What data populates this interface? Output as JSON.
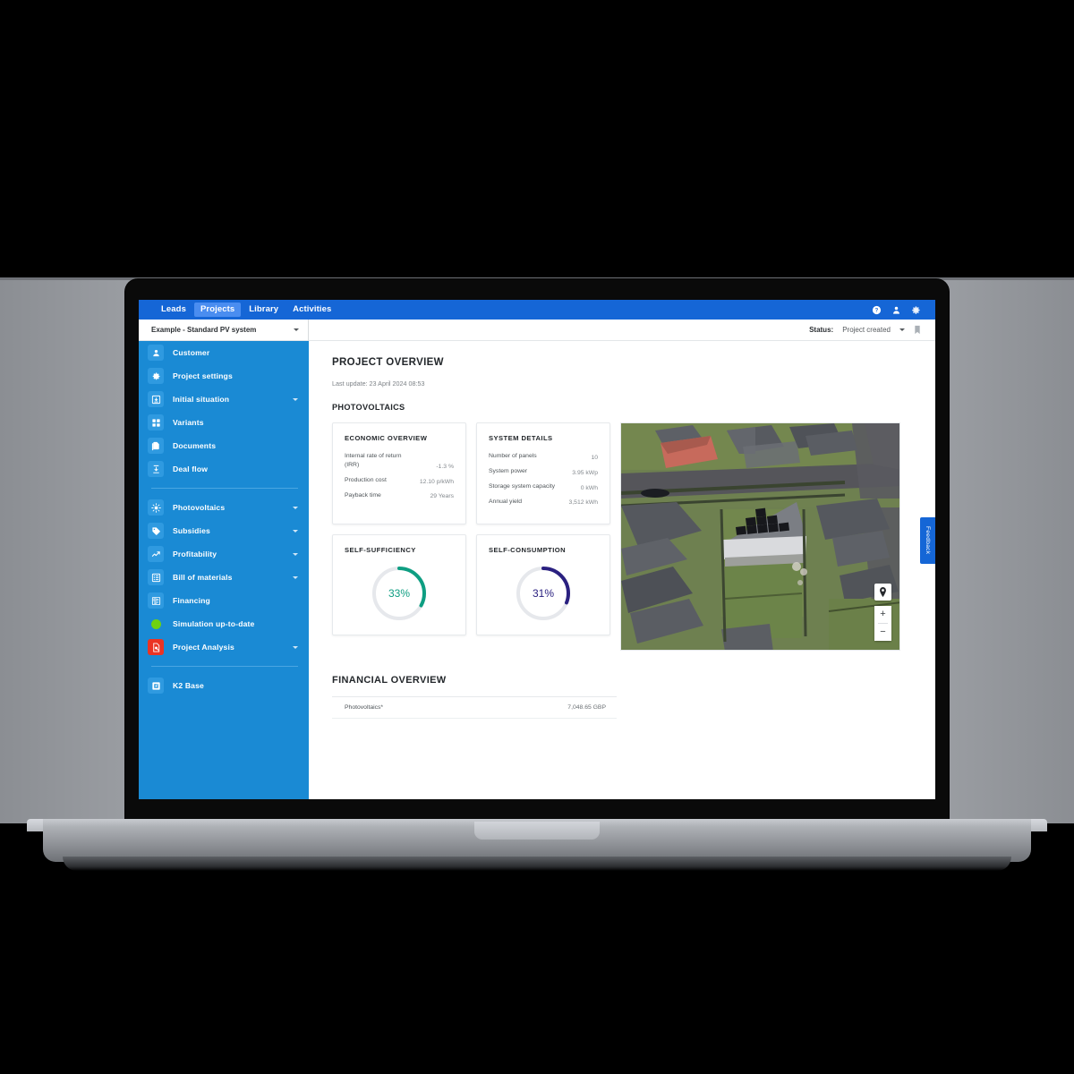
{
  "app": {
    "nav": [
      {
        "label": "Leads",
        "active": false
      },
      {
        "label": "Projects",
        "active": true
      },
      {
        "label": "Library",
        "active": false
      },
      {
        "label": "Activities",
        "active": false
      }
    ],
    "header_icons": [
      {
        "name": "help-icon",
        "glyph": "?"
      },
      {
        "name": "account-icon",
        "glyph": "person"
      },
      {
        "name": "settings-gear-icon",
        "glyph": "gear"
      }
    ]
  },
  "subbar": {
    "project_name": "Example - Standard PV system",
    "status_label": "Status:",
    "status_value": "Project created",
    "bookmark_icon": "bookmark-icon"
  },
  "sidebar": {
    "group1": [
      {
        "label": "Customer",
        "icon": "person-icon",
        "expandable": false
      },
      {
        "label": "Project settings",
        "icon": "gear-icon",
        "expandable": false
      },
      {
        "label": "Initial situation",
        "icon": "download-box-icon",
        "expandable": true
      },
      {
        "label": "Variants",
        "icon": "grid-icon",
        "expandable": false
      },
      {
        "label": "Documents",
        "icon": "documents-icon",
        "expandable": false
      },
      {
        "label": "Deal flow",
        "icon": "deal-flow-icon",
        "expandable": false
      }
    ],
    "group2": [
      {
        "label": "Photovoltaics",
        "icon": "sun-icon",
        "expandable": true
      },
      {
        "label": "Subsidies",
        "icon": "tag-icon",
        "expandable": true
      },
      {
        "label": "Profitability",
        "icon": "trend-up-icon",
        "expandable": true
      },
      {
        "label": "Bill of materials",
        "icon": "list-icon",
        "expandable": true
      },
      {
        "label": "Financing",
        "icon": "financing-icon",
        "expandable": false
      },
      {
        "label": "Simulation up-to-date",
        "icon": "green-status-dot-icon",
        "expandable": false
      },
      {
        "label": "Project Analysis",
        "icon": "analysis-icon",
        "expandable": true,
        "accent": "#eb3323"
      }
    ],
    "group3": [
      {
        "label": "K2 Base",
        "icon": "k2-base-icon",
        "expandable": false
      }
    ],
    "collapse_icon": "chevron-left-icon"
  },
  "main": {
    "page_title": "PROJECT OVERVIEW",
    "last_update": "Last update: 23 April 2024 08:53",
    "pv_heading": "PHOTOVOLTAICS",
    "economic_overview": {
      "title": "ECONOMIC OVERVIEW",
      "rows": [
        {
          "key": "Internal rate of return (IRR)",
          "value": "-1.3 %"
        },
        {
          "key": "Production cost",
          "value": "12.10 p/kWh"
        },
        {
          "key": "Payback time",
          "value": "29 Years"
        }
      ]
    },
    "system_details": {
      "title": "SYSTEM DETAILS",
      "rows": [
        {
          "key": "Number of panels",
          "value": "10"
        },
        {
          "key": "System power",
          "value": "3.95 kWp"
        },
        {
          "key": "Storage system capacity",
          "value": "0 kWh"
        },
        {
          "key": "Annual yield",
          "value": "3,512 kWh"
        }
      ]
    },
    "self_sufficiency": {
      "title": "SELF-SUFFICIENCY",
      "value_text": "33%",
      "percent": 33,
      "color": "#0e9e82",
      "track_color": "#e6e8ec"
    },
    "self_consumption": {
      "title": "SELF-CONSUMPTION",
      "value_text": "31%",
      "percent": 31,
      "color": "#2a2080",
      "track_color": "#e6e8ec"
    },
    "map": {
      "name": "aerial-site-view",
      "locate_icon": "location-pin-icon",
      "zoom_in_label": "+",
      "zoom_out_label": "−"
    },
    "financial_overview": {
      "title": "FINANCIAL OVERVIEW",
      "rows": [
        {
          "key": "Photovoltaics*",
          "value": "7,048.65 GBP"
        }
      ]
    }
  },
  "feedback": {
    "label": "Feedback"
  }
}
